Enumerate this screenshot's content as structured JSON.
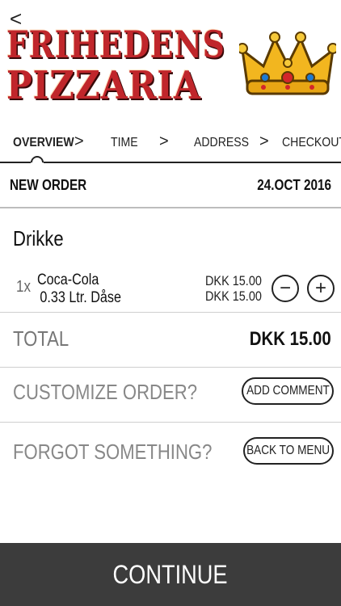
{
  "header": {
    "back_label": "<",
    "logo_line1": "FRIHEDENS",
    "logo_line2": "PIZZARIA",
    "crown_icon": "crown-icon"
  },
  "steps": [
    {
      "label": "OVERVIEW",
      "active": true
    },
    {
      "label": "TIME",
      "active": false
    },
    {
      "label": "ADDRESS",
      "active": false
    },
    {
      "label": "CHECKOUT",
      "active": false
    }
  ],
  "step_separator": ">",
  "order": {
    "title": "NEW ORDER",
    "date": "24.OCT 2016"
  },
  "category": "Drikke",
  "item": {
    "qty": "1x",
    "name_line1": "Coca-Cola",
    "name_line2": "0.33 Ltr. Dåse",
    "price1": "DKK 15.00",
    "price2": "DKK 15.00",
    "minus_label": "−",
    "plus_label": "+"
  },
  "total": {
    "label": "TOTAL",
    "value": "DKK 15.00"
  },
  "customize": {
    "label": "CUSTOMIZE ORDER?",
    "button": "ADD COMMENT"
  },
  "forgot": {
    "label": "FORGOT SOMETHING?",
    "button": "BACK TO MENU"
  },
  "continue_label": "CONTINUE",
  "colors": {
    "brand_red": "#c0262b",
    "continue_bg": "#3c3c3c"
  }
}
